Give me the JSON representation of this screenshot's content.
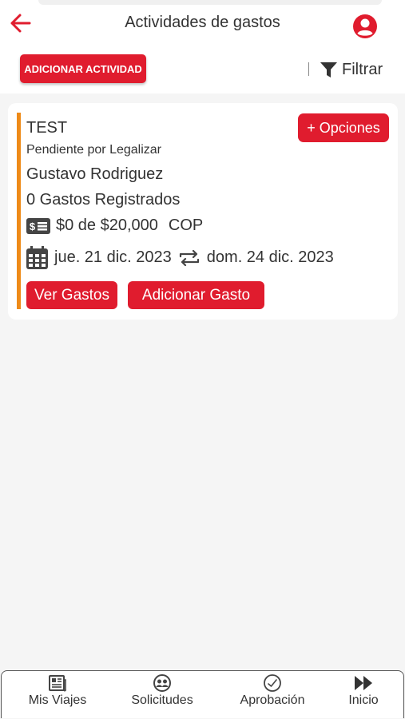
{
  "header": {
    "title": "Actividades de gastos",
    "add_activity_label": "ADICIONAR ACTIVIDAD",
    "filter_label": "Filtrar"
  },
  "activity": {
    "name": "TEST",
    "status": "Pendiente por Legalizar",
    "owner": "Gustavo Rodriguez",
    "expenses_count": "0 Gastos Registrados",
    "amount": "$0 de $20,000",
    "currency": "COP",
    "start_date": "jue. 21 dic. 2023",
    "end_date": "dom. 24 dic. 2023",
    "options_label": "+ Opciones",
    "view_expenses_label": "Ver Gastos",
    "add_expense_label": "Adicionar Gasto"
  },
  "nav": {
    "items": [
      {
        "label": "Mis Viajes",
        "icon": "newspaper-icon"
      },
      {
        "label": "Solicitudes",
        "icon": "people-icon"
      },
      {
        "label": "Aprobación",
        "icon": "approval-check-icon"
      },
      {
        "label": "Inicio",
        "icon": "fast-forward-icon"
      }
    ]
  },
  "colors": {
    "accent_red": "#e01c2e",
    "card_accent_orange": "#ee8a18",
    "background": "#f5f5f5"
  }
}
